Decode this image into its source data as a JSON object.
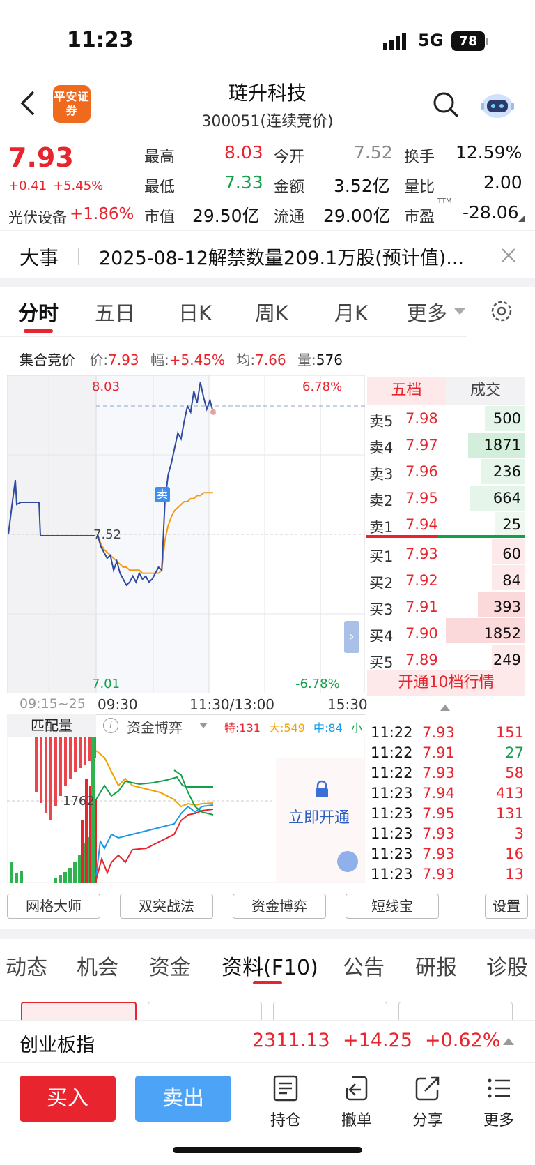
{
  "status_bar": {
    "time": "11:23",
    "network": "5G",
    "battery": "78"
  },
  "header": {
    "broker_logo": "平安证券",
    "title": "琏升科技",
    "subtitle": "300051(连续竞价)"
  },
  "quote": {
    "price": "7.93",
    "change": "+0.41",
    "change_pct": "+5.45%",
    "sector": "光伏设备",
    "sector_pct": "+1.86%",
    "high_label": "最高",
    "high": "8.03",
    "open_label": "今开",
    "open": "7.52",
    "turnover_label": "换手",
    "turnover": "12.59%",
    "low_label": "最低",
    "low": "7.33",
    "amount_label": "金额",
    "amount": "3.52亿",
    "ratio_label": "量比",
    "ratio": "2.00",
    "mcap_label": "市值",
    "mcap": "29.50亿",
    "float_label": "流通",
    "float": "29.00亿",
    "pe_label": "市盈",
    "pe_sup": "TTM",
    "pe": "-28.06"
  },
  "news": {
    "tag": "大事",
    "text": "2025-08-12解禁数量209.1万股(预计值)..."
  },
  "chart_tabs": [
    "分时",
    "五日",
    "日K",
    "周K",
    "月K",
    "更多"
  ],
  "info_line": {
    "label": "集合竞价",
    "price_label": "价:",
    "price": "7.93",
    "pct_label": "幅:",
    "pct": "+5.45%",
    "avg_label": "均:",
    "avg": "7.66",
    "vol_label": "量:",
    "vol": "576"
  },
  "chart_labels": {
    "top_price": "8.03",
    "top_pct": "6.78%",
    "mid_price": "7.52",
    "bottom_price": "7.01",
    "bottom_pct": "-6.78%",
    "time_auction": "09:15~25",
    "time_open": "09:30",
    "time_mid": "11:30/13:00",
    "time_close": "15:30",
    "sell_marker": "卖"
  },
  "chart_data": {
    "type": "line",
    "title": "",
    "ylim": [
      7.01,
      8.03
    ],
    "y_reference": 7.52,
    "x_labels": [
      "09:30",
      "11:30/13:00",
      "15:30"
    ],
    "series": [
      {
        "values": [
          7.52,
          7.48,
          7.46,
          7.44,
          7.45,
          7.4,
          7.43,
          7.39,
          7.37,
          7.35,
          7.36,
          7.38,
          7.36,
          7.39,
          7.37,
          7.38,
          7.36,
          7.37,
          7.39,
          7.41,
          7.4,
          7.63,
          7.72,
          7.76,
          7.81,
          7.86,
          7.84,
          7.9,
          7.95,
          7.93,
          8.0,
          7.96,
          8.03,
          7.98,
          7.94,
          7.97,
          7.93
        ]
      },
      {
        "values": [
          7.52,
          7.49,
          7.47,
          7.46,
          7.45,
          7.44,
          7.43,
          7.42,
          7.41,
          7.41,
          7.4,
          7.4,
          7.4,
          7.4,
          7.39,
          7.39,
          7.39,
          7.39,
          7.39,
          7.39,
          7.4,
          7.5,
          7.55,
          7.58,
          7.6,
          7.61,
          7.62,
          7.63,
          7.63,
          7.64,
          7.64,
          7.65,
          7.65,
          7.66,
          7.66,
          7.66,
          7.66
        ]
      }
    ]
  },
  "order_book": {
    "tab_active": "五档",
    "tab_other": "成交",
    "asks": [
      {
        "label": "卖5",
        "price": "7.98",
        "vol": "500"
      },
      {
        "label": "卖4",
        "price": "7.97",
        "vol": "1871"
      },
      {
        "label": "卖3",
        "price": "7.96",
        "vol": "236"
      },
      {
        "label": "卖2",
        "price": "7.95",
        "vol": "664"
      },
      {
        "label": "卖1",
        "price": "7.94",
        "vol": "25"
      }
    ],
    "bids": [
      {
        "label": "买1",
        "price": "7.93",
        "vol": "60"
      },
      {
        "label": "买2",
        "price": "7.92",
        "vol": "84"
      },
      {
        "label": "买3",
        "price": "7.91",
        "vol": "393"
      },
      {
        "label": "买4",
        "price": "7.90",
        "vol": "1852"
      },
      {
        "label": "买5",
        "price": "7.89",
        "vol": "249"
      }
    ],
    "upgrade": "开通10档行情"
  },
  "ticks": [
    {
      "time": "11:22",
      "price": "7.93",
      "vol": "151",
      "dir": "red"
    },
    {
      "time": "11:22",
      "price": "7.91",
      "vol": "27",
      "dir": "green"
    },
    {
      "time": "11:22",
      "price": "7.93",
      "vol": "58",
      "dir": "red"
    },
    {
      "time": "11:23",
      "price": "7.94",
      "vol": "413",
      "dir": "red"
    },
    {
      "time": "11:23",
      "price": "7.95",
      "vol": "131",
      "dir": "red"
    },
    {
      "time": "11:23",
      "price": "7.93",
      "vol": "3",
      "dir": "red"
    },
    {
      "time": "11:23",
      "price": "7.93",
      "vol": "16",
      "dir": "red"
    },
    {
      "time": "11:23",
      "price": "7.93",
      "vol": "13",
      "dir": "red"
    }
  ],
  "lower_panel": {
    "match_label": "匹配量",
    "game_label": "资金博弈",
    "legend": [
      {
        "text": "特:131",
        "color": "#e8252e"
      },
      {
        "text": "大:549",
        "color": "#f0a000"
      },
      {
        "text": "中:84",
        "color": "#1a9be8"
      },
      {
        "text": "小:",
        "color": "#14a04a"
      }
    ],
    "level": "1762",
    "unlock": "立即开通"
  },
  "tools": [
    "网格大师",
    "双突战法",
    "资金博弈",
    "短线宝",
    "设置"
  ],
  "bottom_tabs": [
    "动态",
    "机会",
    "资金",
    "资料(F10)",
    "公告",
    "研报",
    "诊股"
  ],
  "index_bar": {
    "name": "创业板指",
    "value": "2311.13",
    "change": "+14.25",
    "pct": "+0.62%"
  },
  "actions": {
    "buy": "买入",
    "sell": "卖出",
    "hold": "持仓",
    "cancel": "撤单",
    "share": "分享",
    "more": "更多"
  }
}
